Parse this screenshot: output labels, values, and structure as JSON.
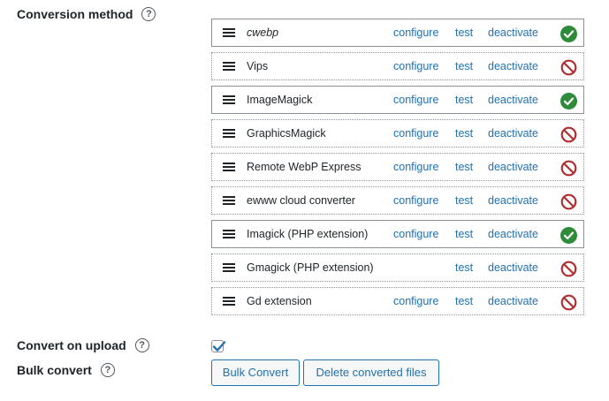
{
  "conversion_method": {
    "label": "Conversion method",
    "help": "?",
    "converters": [
      {
        "name": "cwebp",
        "italic": true,
        "configure": "configure",
        "test": "test",
        "deactivate": "deactivate",
        "status": "active"
      },
      {
        "name": "Vips",
        "italic": false,
        "configure": "configure",
        "test": "test",
        "deactivate": "deactivate",
        "status": "inactive"
      },
      {
        "name": "ImageMagick",
        "italic": false,
        "configure": "configure",
        "test": "test",
        "deactivate": "deactivate",
        "status": "active"
      },
      {
        "name": "GraphicsMagick",
        "italic": false,
        "configure": "configure",
        "test": "test",
        "deactivate": "deactivate",
        "status": "inactive"
      },
      {
        "name": "Remote WebP Express",
        "italic": false,
        "configure": "configure",
        "test": "test",
        "deactivate": "deactivate",
        "status": "inactive"
      },
      {
        "name": "ewww cloud converter",
        "italic": false,
        "configure": "configure",
        "test": "test",
        "deactivate": "deactivate",
        "status": "inactive"
      },
      {
        "name": "Imagick (PHP extension)",
        "italic": false,
        "configure": "configure",
        "test": "test",
        "deactivate": "deactivate",
        "status": "active"
      },
      {
        "name": "Gmagick (PHP extension)",
        "italic": false,
        "configure": "",
        "test": "test",
        "deactivate": "deactivate",
        "status": "inactive"
      },
      {
        "name": "Gd extension",
        "italic": false,
        "configure": "configure",
        "test": "test",
        "deactivate": "deactivate",
        "status": "inactive"
      }
    ]
  },
  "convert_on_upload": {
    "label": "Convert on upload",
    "help": "?",
    "checked": true
  },
  "bulk_convert": {
    "label": "Bulk convert",
    "help": "?",
    "bulk_button": "Bulk Convert",
    "delete_button": "Delete converted files"
  },
  "colors": {
    "link": "#2271b1",
    "success": "#2e8b3a",
    "error": "#b32d2e",
    "border": "#8c8f94"
  },
  "icons": {
    "active": "check-circle-icon",
    "inactive": "prohibited-icon",
    "drag": "drag-handle-icon",
    "help": "question-circle-icon"
  }
}
